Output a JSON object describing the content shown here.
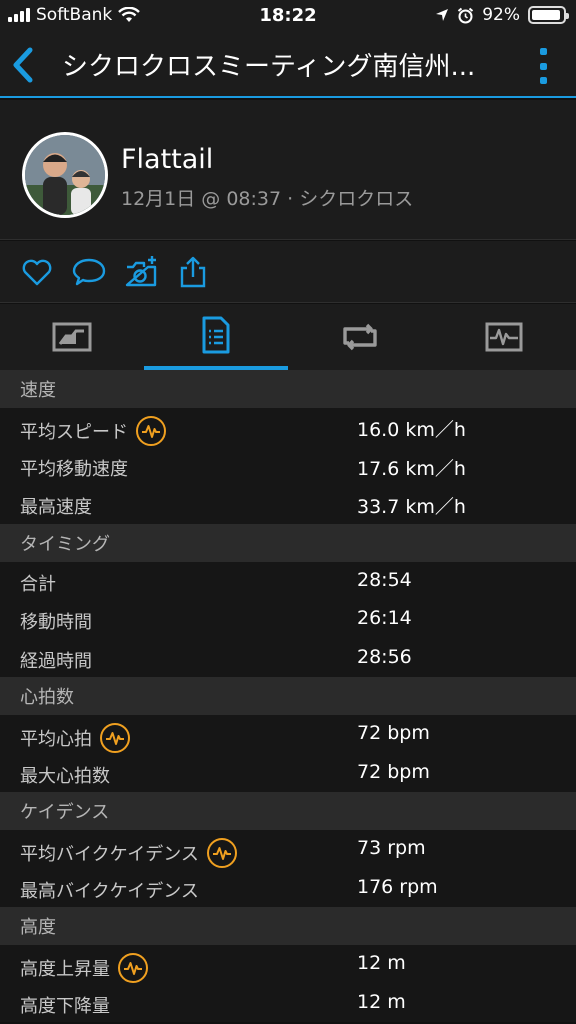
{
  "status_bar": {
    "carrier": "SoftBank",
    "time": "18:22",
    "battery": "92%",
    "battery_level": 0.92
  },
  "nav": {
    "title": "シクロクロスミーティング南信州..."
  },
  "profile": {
    "name": "Flattail",
    "meta": "12月1日 @ 08:37 · シクロクロス"
  },
  "actions": [
    "like-icon",
    "comment-icon",
    "add-photo-icon",
    "share-icon"
  ],
  "tabs": [
    "summary-chart-icon",
    "stats-list-icon",
    "laps-icon",
    "graph-icon"
  ],
  "active_tab": 1,
  "colors": {
    "accent": "#1a9be0",
    "badge": "#f0a020"
  },
  "sections": [
    {
      "title": "速度",
      "rows": [
        {
          "label": "平均スピード",
          "value": "16.0 km／h",
          "badge": true
        },
        {
          "label": "平均移動速度",
          "value": "17.6 km／h",
          "badge": false
        },
        {
          "label": "最高速度",
          "value": "33.7 km／h",
          "badge": false
        }
      ]
    },
    {
      "title": "タイミング",
      "rows": [
        {
          "label": "合計",
          "value": "28:54",
          "badge": false
        },
        {
          "label": "移動時間",
          "value": "26:14",
          "badge": false
        },
        {
          "label": "経過時間",
          "value": "28:56",
          "badge": false
        }
      ]
    },
    {
      "title": "心拍数",
      "rows": [
        {
          "label": "平均心拍",
          "value": "72 bpm",
          "badge": true
        },
        {
          "label": "最大心拍数",
          "value": "72 bpm",
          "badge": false
        }
      ]
    },
    {
      "title": "ケイデンス",
      "rows": [
        {
          "label": "平均バイクケイデンス",
          "value": "73 rpm",
          "badge": true
        },
        {
          "label": "最高バイクケイデンス",
          "value": "176 rpm",
          "badge": false
        }
      ]
    },
    {
      "title": "高度",
      "rows": [
        {
          "label": "高度上昇量",
          "value": "12 m",
          "badge": true
        },
        {
          "label": "高度下降量",
          "value": "12 m",
          "badge": false
        }
      ]
    }
  ]
}
